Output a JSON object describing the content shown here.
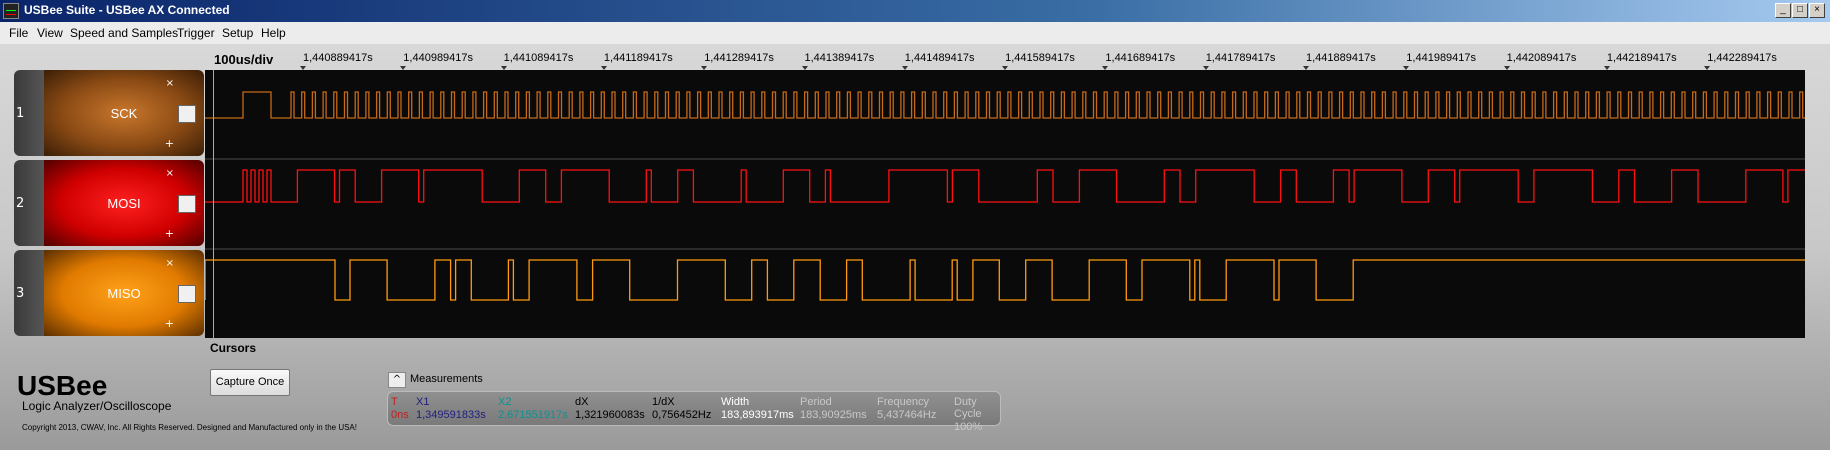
{
  "window": {
    "title": "USBee Suite - USBee AX Connected",
    "min": "_",
    "max": "□",
    "close": "×"
  },
  "menu": [
    "File",
    "View",
    "Speed and Samples",
    "Trigger",
    "Setup",
    "Help"
  ],
  "overview": {
    "left_arrow": "<"
  },
  "timebase": "100us/div",
  "ticks": [
    "1,440889417s",
    "1,440989417s",
    "1,441089417s",
    "1,441189417s",
    "1,441289417s",
    "1,441389417s",
    "1,441489417s",
    "1,441589417s",
    "1,441689417s",
    "1,441789417s",
    "1,441889417s",
    "1,441989417s",
    "1,442089417s",
    "1,442189417s",
    "1,442289417s"
  ],
  "channels": [
    {
      "num": "1",
      "name": "SCK",
      "color": "#c56a1a",
      "remove": "×",
      "add": "+"
    },
    {
      "num": "2",
      "name": "MOSI",
      "color": "#ff1010",
      "remove": "×",
      "add": "+"
    },
    {
      "num": "3",
      "name": "MISO",
      "color": "#ff9a10",
      "remove": "×",
      "add": "+"
    }
  ],
  "cursors_label": "Cursors",
  "brand": {
    "logo": "USBee",
    "subtitle": "Logic Analyzer/Oscilloscope",
    "copyright": "Copyright 2013, CWAV, Inc. All Rights Reserved. Designed and Manufactured only in the USA!"
  },
  "capture_button": "Capture Once",
  "measurements": {
    "title": "Measurements",
    "toggle": "^",
    "columns": [
      {
        "h": "T",
        "v": "0ns",
        "color": "#c02020"
      },
      {
        "h": "X1",
        "v": "1,349591833s",
        "color": "#202080"
      },
      {
        "h": "X2",
        "v": "2,671551917s",
        "color": "#109090"
      },
      {
        "h": "dX",
        "v": "1,321960083s",
        "color": "#000000"
      },
      {
        "h": "1/dX",
        "v": "0,756452Hz",
        "color": "#000000"
      },
      {
        "h": "Width",
        "v": "183,893917ms",
        "color": "#ffffff"
      },
      {
        "h": "Period",
        "v": "183,90925ms",
        "color": "#c8c8c8"
      },
      {
        "h": "Frequency",
        "v": "5,437464Hz",
        "color": "#c8c8c8"
      },
      {
        "h": "Duty Cycle",
        "v": "100%",
        "color": "#c8c8c8"
      }
    ]
  }
}
